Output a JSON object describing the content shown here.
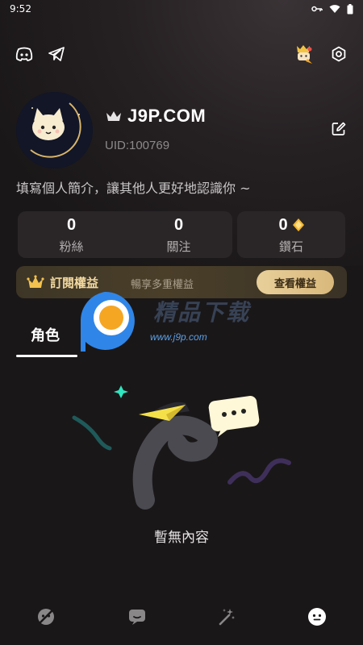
{
  "status_bar": {
    "time": "9:52"
  },
  "profile": {
    "username": "J9P.COM",
    "uid": "UID:100769",
    "bio_placeholder": "填寫個人簡介，讓其他人更好地認識你 ~"
  },
  "stats": {
    "fans": {
      "value": "0",
      "label": "粉絲"
    },
    "following": {
      "value": "0",
      "label": "關注"
    },
    "diamonds": {
      "value": "0",
      "label": "鑽石"
    }
  },
  "subscription": {
    "title": "訂閱權益",
    "description": "暢享多重權益",
    "button_label": "查看權益"
  },
  "tabs": [
    {
      "label": "角色",
      "active": true
    }
  ],
  "watermark": {
    "text": "精品下载",
    "url": "www.j9p.com"
  },
  "empty_state": {
    "text": "暫無內容"
  },
  "bottom_nav": [
    {
      "icon": "discover-icon",
      "active": false
    },
    {
      "icon": "chat-icon",
      "active": false
    },
    {
      "icon": "magic-wand-icon",
      "active": false
    },
    {
      "icon": "profile-face-icon",
      "active": true
    }
  ],
  "colors": {
    "background": "#1a1718",
    "card": "#2a2627",
    "gold": "#f2d9a0",
    "gold_button": "#e8cf9a",
    "accent_teal": "#2ee6c0",
    "accent_yellow": "#f5e04a"
  }
}
